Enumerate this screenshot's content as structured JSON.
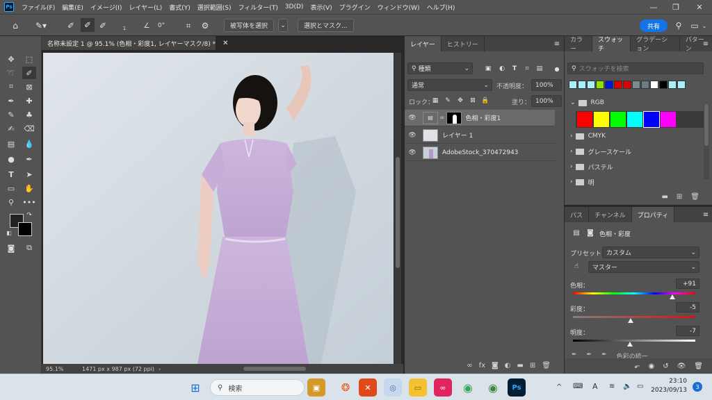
{
  "app": {
    "logo": "Ps",
    "title_tab": "名称未設定 1 @ 95.1% (色相・彩度1, レイヤーマスク/8) *"
  },
  "menu": [
    "ファイル(F)",
    "編集(E)",
    "イメージ(I)",
    "レイヤー(L)",
    "書式(Y)",
    "選択範囲(S)",
    "フィルター(T)",
    "3D(D)",
    "表示(V)",
    "プラグイン",
    "ウィンドウ(W)",
    "ヘルプ(H)"
  ],
  "options": {
    "brush_size": "1",
    "angle": "0°",
    "select_subject": "被写体を選択",
    "select_mask": "選択とマスク...",
    "share": "共有"
  },
  "status": {
    "zoom": "95.1%",
    "doc_info": "1471 px x 987 px (72 ppi)"
  },
  "layers_panel": {
    "tabs": [
      "レイヤー",
      "ヒストリー"
    ],
    "filter_kind": "種類",
    "blend_mode": "通常",
    "opacity_label": "不透明度：",
    "opacity_value": "100%",
    "lock_label": "ロック：",
    "fill_label": "塗り：",
    "fill_value": "100%",
    "layers": [
      {
        "name": "色相・彩度1",
        "selected": true
      },
      {
        "name": "レイヤー 1",
        "selected": false
      },
      {
        "name": "AdobeStock_370472943",
        "selected": false
      }
    ]
  },
  "swatches_panel": {
    "tabs": [
      "カラー",
      "スウォッチ",
      "グラデーション",
      "パターン"
    ],
    "search_placeholder": "スウォッチを検索",
    "recent_colors": [
      "#a8f0f8",
      "#a8f0f8",
      "#a8f0f8",
      "#8ee000",
      "#0018e0",
      "#e00000",
      "#e00000",
      "#808890",
      "#6a7c88",
      "#ffffff",
      "#000000",
      "#a8f0f8",
      "#a8f0f8"
    ],
    "groups": [
      {
        "name": "RGB",
        "open": true,
        "colors": [
          "#ff0000",
          "#ffff00",
          "#00ff00",
          "#00ffff",
          "#0000ff",
          "#ff00ff"
        ]
      },
      {
        "name": "CMYK",
        "open": false
      },
      {
        "name": "グレースケール",
        "open": false
      },
      {
        "name": "パステル",
        "open": false
      },
      {
        "name": "明",
        "open": false
      }
    ]
  },
  "properties_panel": {
    "tabs": [
      "パス",
      "チャンネル",
      "プロパティ"
    ],
    "adjustment_title": "色相・彩度",
    "preset_label": "プリセット：",
    "preset_value": "カスタム",
    "channel_value": "マスター",
    "hue_label": "色相：",
    "hue_value": "+91",
    "saturation_label": "彩度：",
    "saturation_value": "-5",
    "lightness_label": "明度：",
    "lightness_value": "-7",
    "colorize_label": "色彩の統一"
  },
  "taskbar": {
    "search_placeholder": "検索",
    "time": "23:10",
    "date": "2023/09/13",
    "notification_count": "3",
    "ime": "A"
  }
}
